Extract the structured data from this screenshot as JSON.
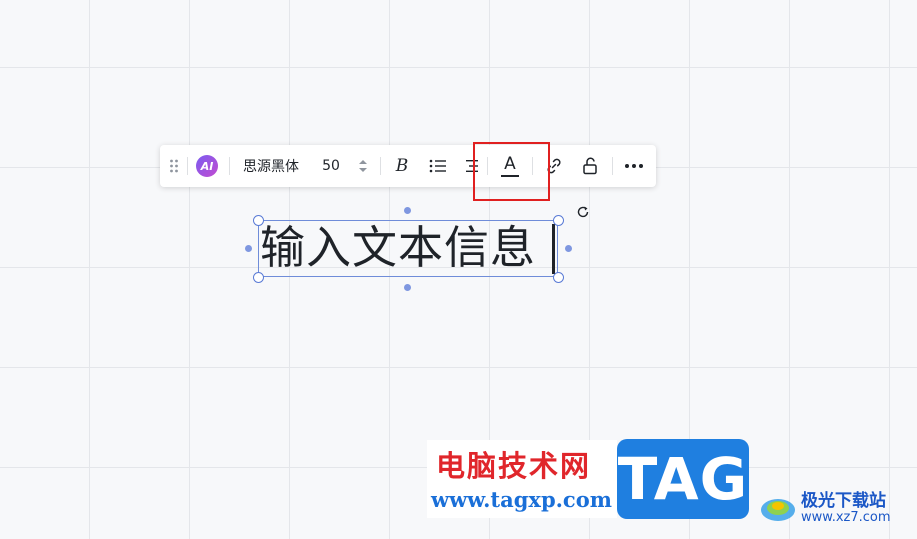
{
  "toolbar": {
    "drag_icon": "drag-handle-icon",
    "ai_label": "AI",
    "font_name": "思源黑体",
    "font_size": "50",
    "stepper_icon": "up-down-stepper-icon",
    "bold_label": "B",
    "list_icon": "bullet-list-icon",
    "align_icon": "align-icon",
    "text_color_label": "A",
    "link_icon": "link-icon",
    "lock_icon": "unlock-icon",
    "more_icon": "more-icon",
    "highlight_color": "#e02020"
  },
  "canvas": {
    "text_content": "输入文本信息",
    "selection_color": "#6f8cd9",
    "rotate_icon": "rotate-icon"
  },
  "watermark": {
    "site_name": "电脑技术网",
    "site_url": "www.tagxp.com",
    "tag": "TAG",
    "right_name": "极光下载站",
    "right_url": "www.xz7.com"
  }
}
